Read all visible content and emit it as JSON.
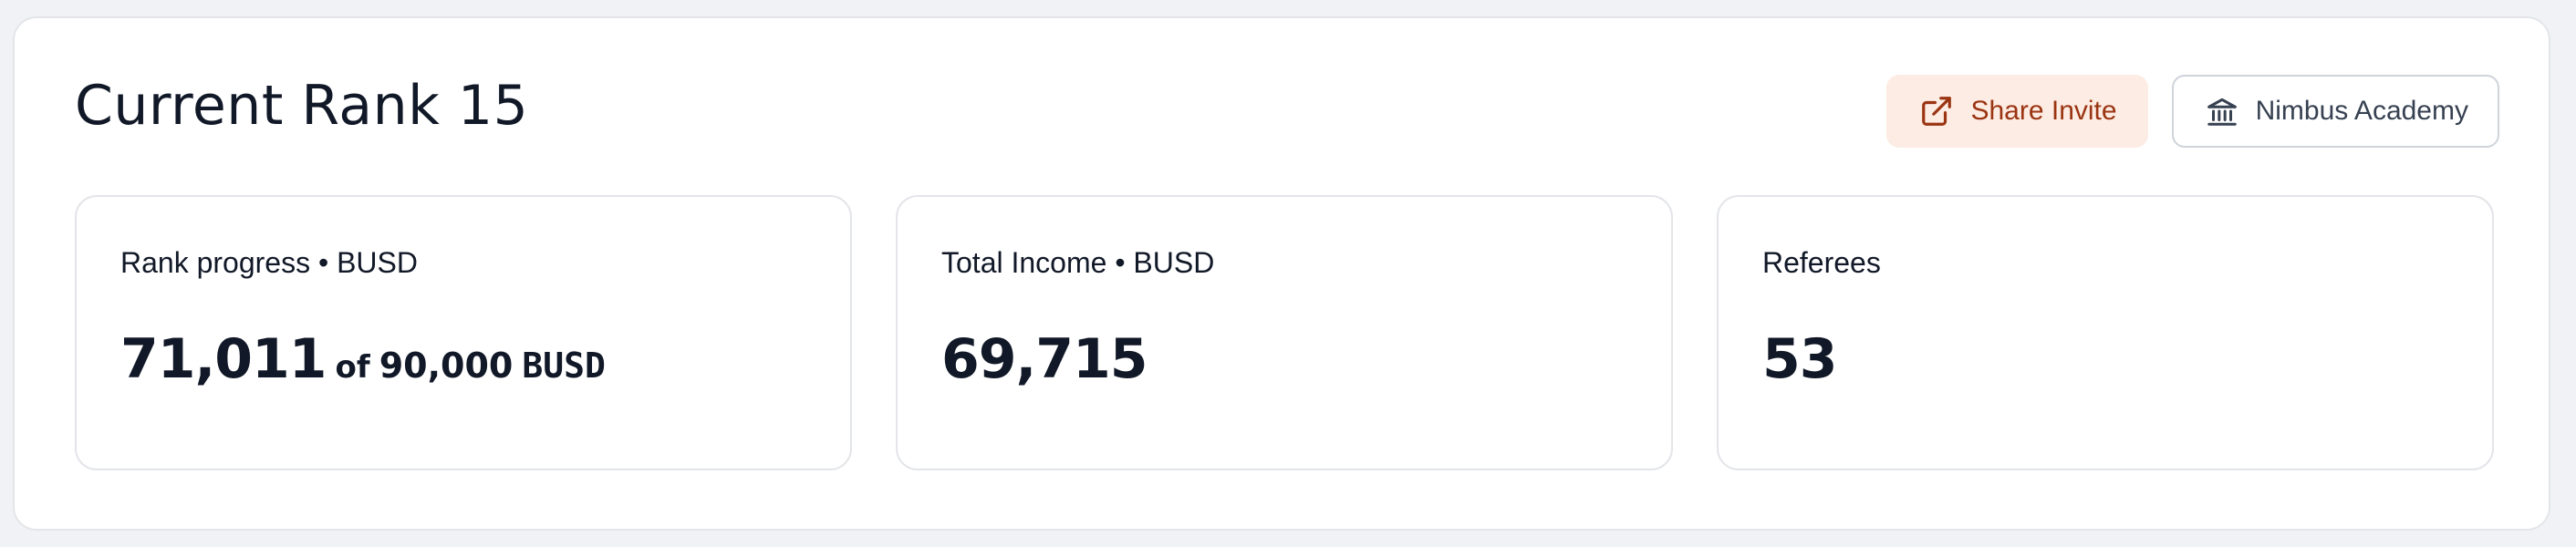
{
  "header": {
    "title": "Current Rank 15"
  },
  "actions": {
    "share_label": "Share Invite",
    "share_icon": "external-link-icon",
    "academy_label": "Nimbus Academy",
    "academy_icon": "bank-icon"
  },
  "cards": [
    {
      "label": "Rank progress • BUSD",
      "value": "71,011",
      "of_word": "of",
      "total": "90,000",
      "unit": "BUSD"
    },
    {
      "label": "Total Income • BUSD",
      "value": "69,715"
    },
    {
      "label": "Referees",
      "value": "53"
    }
  ],
  "colors": {
    "share_bg": "#fdece3",
    "share_text": "#9a3412",
    "text": "#111827",
    "border": "#e3e5e9"
  }
}
